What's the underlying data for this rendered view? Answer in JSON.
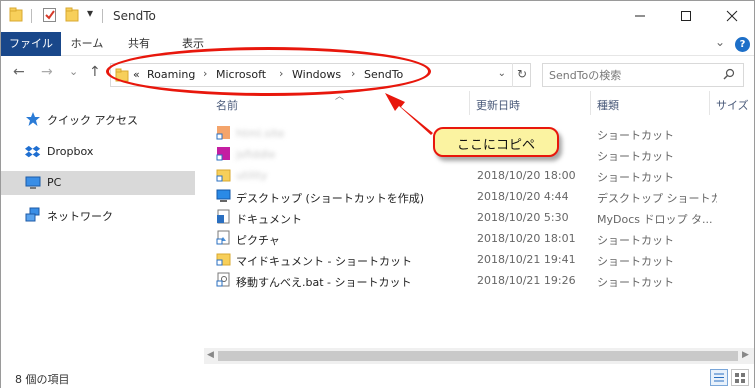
{
  "window": {
    "title": "SendTo",
    "qa_dropdown": "▾"
  },
  "ribbon": {
    "tabs": [
      "ファイル",
      "ホーム",
      "共有",
      "表示"
    ],
    "expand_glyph": "⌄",
    "help_glyph": "?"
  },
  "nav": {
    "back": "←",
    "forward": "→",
    "recent": "⌄",
    "up": "↑"
  },
  "address": {
    "overflow": "«",
    "breadcrumbs": [
      "Roaming",
      "Microsoft",
      "Windows",
      "SendTo"
    ],
    "separator": "›",
    "dropdown": "⌄",
    "refresh": "↻"
  },
  "search": {
    "placeholder": "SendToの検索"
  },
  "sidebar": {
    "items": [
      {
        "label": "クイック アクセス",
        "icon": "star-icon"
      },
      {
        "label": "Dropbox",
        "icon": "dropbox-icon"
      },
      {
        "label": "PC",
        "icon": "pc-icon",
        "selected": true
      },
      {
        "label": "ネットワーク",
        "icon": "network-icon"
      }
    ]
  },
  "columns": {
    "name": "名前",
    "date": "更新日時",
    "type": "種類",
    "size": "サイズ"
  },
  "files": [
    {
      "name": "html.site",
      "date": "",
      "type": "ショートカット",
      "icon": "app-shortcut-icon",
      "blurred": true
    },
    {
      "name": "jsfiddle",
      "date": "",
      "type": "ショートカット",
      "icon": "app-shortcut-icon",
      "blurred": true
    },
    {
      "name": "utility",
      "date": "2018/10/20 18:00",
      "type": "ショートカット",
      "icon": "folder-icon",
      "blurred": true
    },
    {
      "name": "デスクトップ (ショートカットを作成)",
      "date": "2018/10/20 4:44",
      "type": "デスクトップ ショートカ...",
      "icon": "desktop-icon",
      "blurred": false
    },
    {
      "name": "ドキュメント",
      "date": "2018/10/20 5:30",
      "type": "MyDocs ドロップ タ...",
      "icon": "document-icon",
      "blurred": false
    },
    {
      "name": "ピクチャ",
      "date": "2018/10/20 18:01",
      "type": "ショートカット",
      "icon": "picture-shortcut-icon",
      "blurred": false
    },
    {
      "name": "マイドキュメント - ショートカット",
      "date": "2018/10/21 19:41",
      "type": "ショートカット",
      "icon": "folder-shortcut-icon",
      "blurred": false
    },
    {
      "name": "移動すんべえ.bat - ショートカット",
      "date": "2018/10/21 19:26",
      "type": "ショートカット",
      "icon": "bat-shortcut-icon",
      "blurred": false
    }
  ],
  "status": {
    "count": "8 個の項目"
  },
  "annotation": {
    "callout": "ここにコピペ"
  },
  "colors": {
    "file_tab": "#19478a",
    "annotation_red": "#e8170c",
    "callout_fill": "#fbf3a1",
    "sidebar_selected": "#d9d9d9"
  }
}
